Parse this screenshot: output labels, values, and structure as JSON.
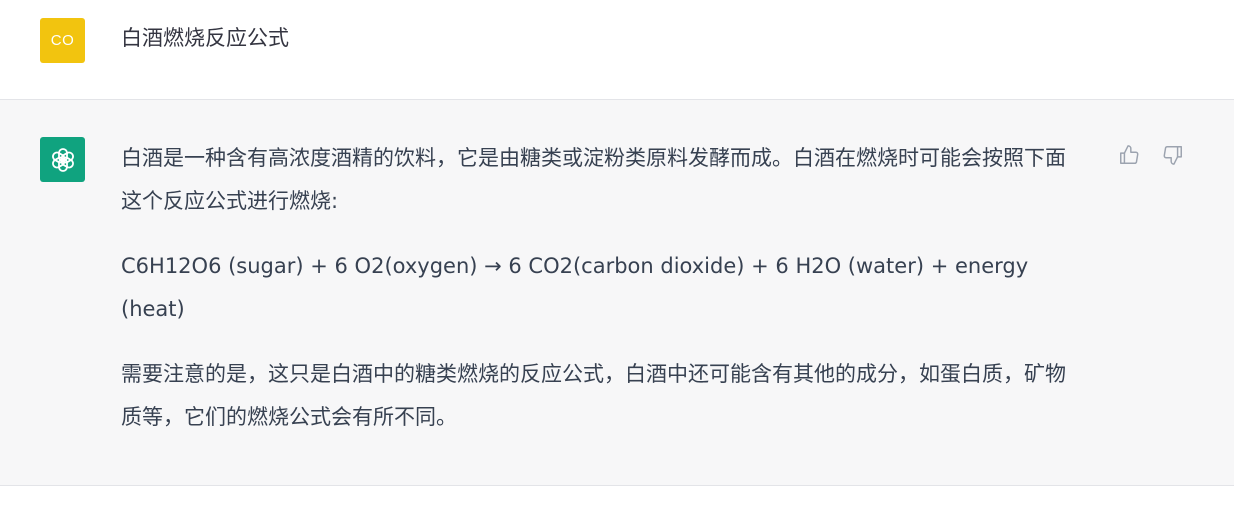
{
  "user": {
    "avatar_initials": "CO",
    "avatar_color": "#f2c40f",
    "message": "白酒燃烧反应公式"
  },
  "assistant": {
    "avatar_icon": "openai-logo-icon",
    "avatar_color": "#10a37f",
    "paragraphs": [
      "白酒是一种含有高浓度酒精的饮料，它是由糖类或淀粉类原料发酵而成。白酒在燃烧时可能会按照下面这个反应公式进行燃烧:",
      "C6H12O6 (sugar) + 6 O2(oxygen) → 6 CO2(carbon dioxide) + 6 H2O (water) + energy (heat)",
      "需要注意的是，这只是白酒中的糖类燃烧的反应公式，白酒中还可能含有其他的成分，如蛋白质，矿物质等，它们的燃烧公式会有所不同。"
    ],
    "feedback_icons": [
      "thumbs-up-icon",
      "thumbs-down-icon"
    ]
  }
}
